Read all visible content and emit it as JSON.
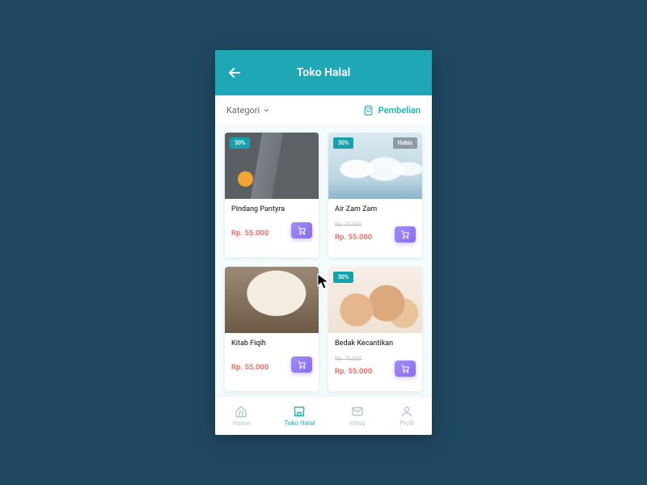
{
  "header": {
    "title": "Toko Halal"
  },
  "subheader": {
    "category_label": "Kategori",
    "purchase_label": "Pembelian"
  },
  "products": [
    {
      "name": "Pindang Pantyra",
      "price": "Rp. 55.000",
      "old_price": "",
      "discount": "30%",
      "status": "",
      "image": "fish"
    },
    {
      "name": "Air Zam Zam",
      "price": "Rp. 55.000",
      "old_price": "Rp. 70.000",
      "discount": "30%",
      "status": "Habis",
      "image": "water"
    },
    {
      "name": "Kitab Fiqih",
      "price": "Rp. 55.000",
      "old_price": "",
      "discount": "",
      "status": "",
      "image": "book"
    },
    {
      "name": "Bedak Kecantikan",
      "price": "Rp. 55.000",
      "old_price": "Rp. 70.000",
      "discount": "30%",
      "status": "",
      "image": "powder"
    }
  ],
  "nav": {
    "items": [
      {
        "label": "Home",
        "active": false
      },
      {
        "label": "Toko Halal",
        "active": true
      },
      {
        "label": "Inbox",
        "active": false
      },
      {
        "label": "Profil",
        "active": false
      }
    ]
  },
  "colors": {
    "brand": "#1fa7b6",
    "accent": "#1fb2b0",
    "price": "#ee6a5f",
    "cart": "#8a6cf2"
  }
}
